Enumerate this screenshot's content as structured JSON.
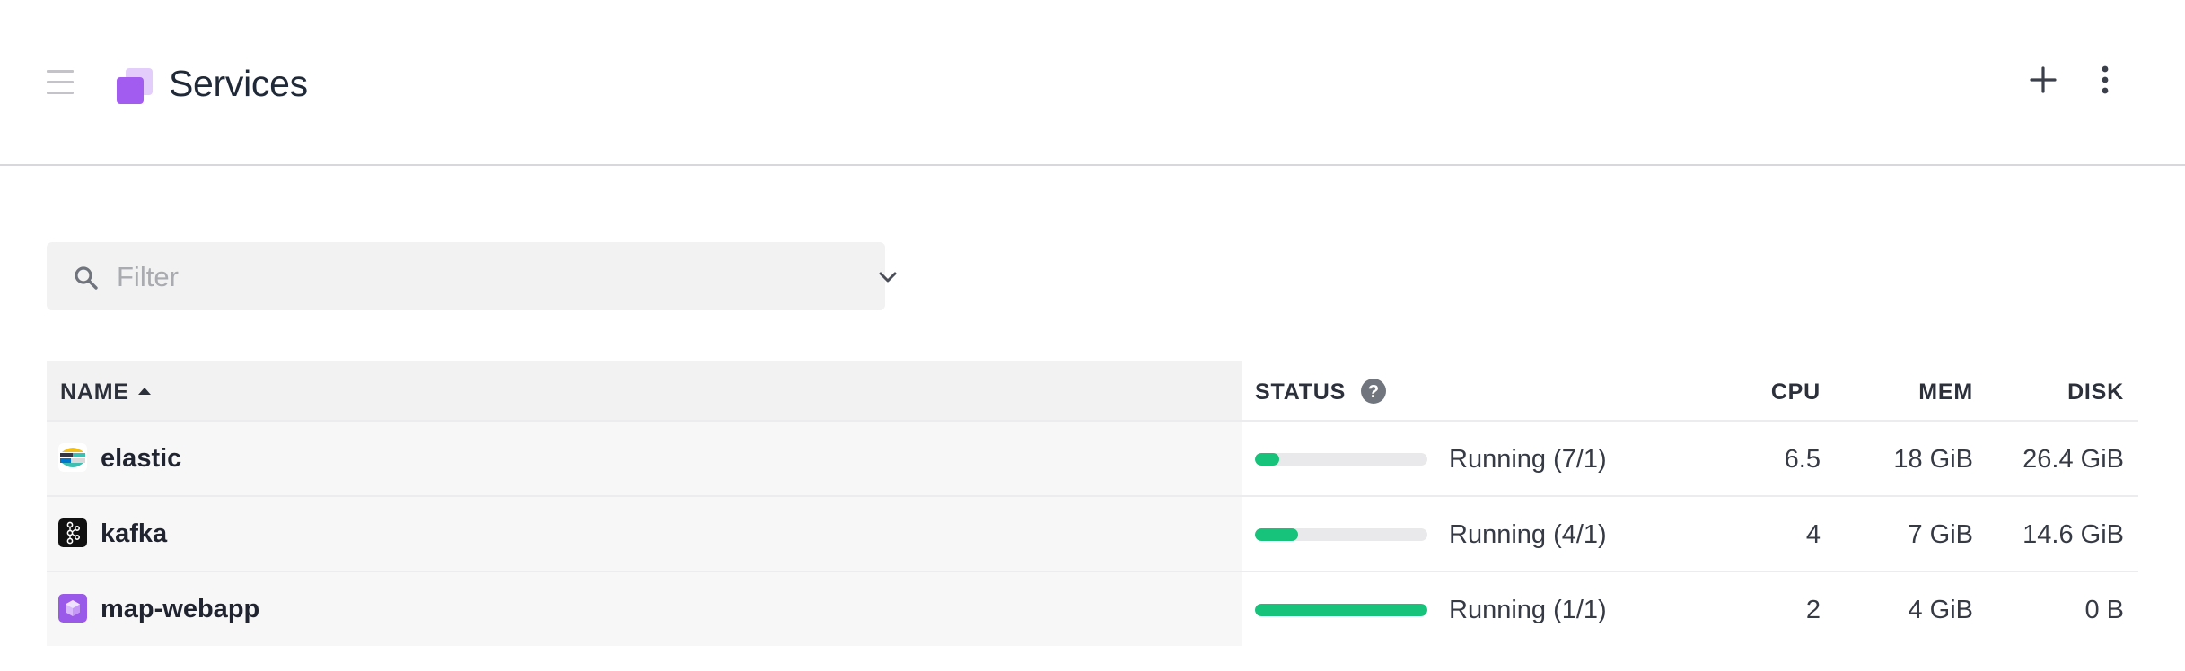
{
  "header": {
    "title": "Services",
    "icons": {
      "menu": "hamburger-icon",
      "logo": "services-cube-icon",
      "add": "plus-icon",
      "more": "vertical-ellipsis-icon"
    }
  },
  "filter": {
    "placeholder": "Filter",
    "value": ""
  },
  "table": {
    "columns": {
      "name": "NAME",
      "status": "STATUS",
      "cpu": "CPU",
      "mem": "MEM",
      "disk": "DISK"
    },
    "sort": {
      "column": "name",
      "direction": "ascending"
    },
    "rows": [
      {
        "name": "elastic",
        "icon": "elastic-icon",
        "status": "Running (7/1)",
        "progress": 0.14,
        "cpu": "6.5",
        "mem": "18 GiB",
        "disk": "26.4 GiB"
      },
      {
        "name": "kafka",
        "icon": "kafka-icon",
        "status": "Running (4/1)",
        "progress": 0.25,
        "cpu": "4",
        "mem": "7 GiB",
        "disk": "14.6 GiB"
      },
      {
        "name": "map-webapp",
        "icon": "webapp-cube-icon",
        "status": "Running (1/1)",
        "progress": 1.0,
        "cpu": "2",
        "mem": "4 GiB",
        "disk": "0 B"
      }
    ]
  },
  "colors": {
    "accent": "#9b59ea",
    "running": "#17c27a",
    "track": "#e9e9eb"
  }
}
